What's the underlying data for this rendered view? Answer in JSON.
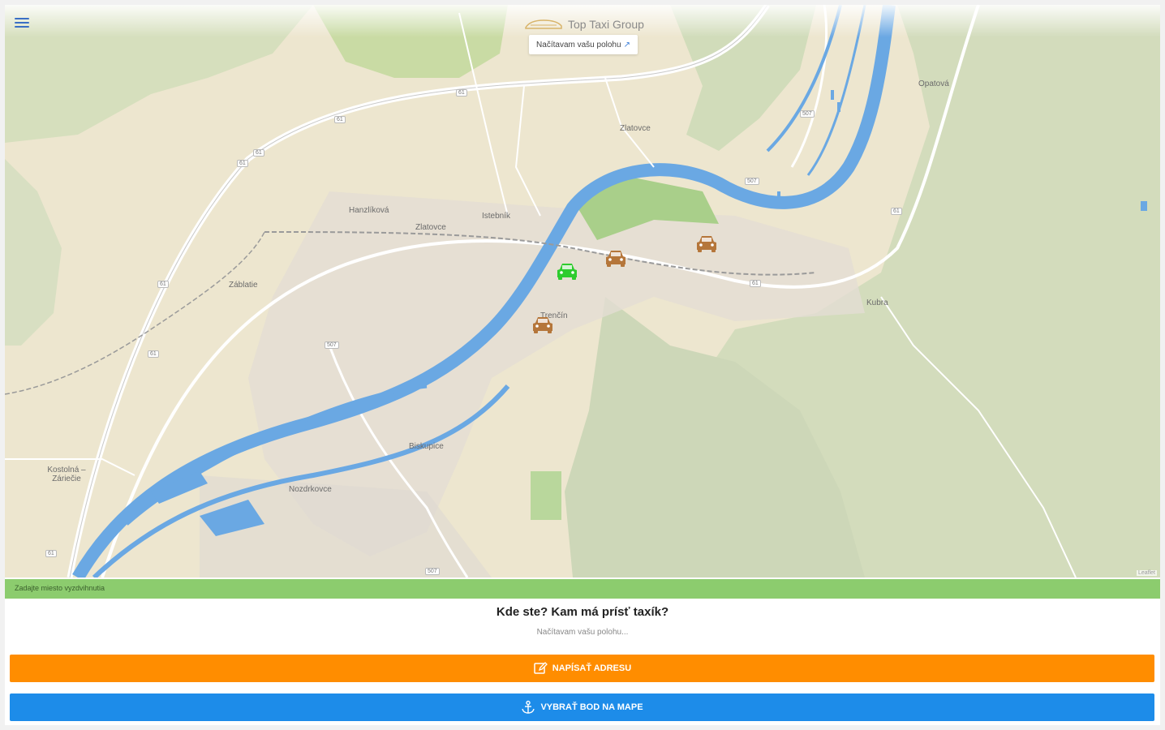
{
  "app": {
    "title": "Top Taxi Group",
    "locating_text": "Načítavam vašu polohu",
    "locating_icon": "location-arrow-icon"
  },
  "map": {
    "labels": [
      {
        "text": "Opatová"
      },
      {
        "text": "Zlatovce"
      },
      {
        "text": "Hanzlíková"
      },
      {
        "text": "Zlatovce"
      },
      {
        "text": "Kubra"
      },
      {
        "text": "Záblatie"
      },
      {
        "text": "Trenčín"
      },
      {
        "text": "Biskupice"
      },
      {
        "text": "Nozdrkovce"
      },
      {
        "text": "Kostolná – Záriečie"
      },
      {
        "text": "Istebník"
      }
    ],
    "shields": [
      "61",
      "61",
      "61",
      "61",
      "507",
      "507",
      "61",
      "61",
      "61",
      "61",
      "61",
      "507",
      "507"
    ],
    "attribution": "Leaflet",
    "taxi_icon_free": "car-icon-green",
    "taxi_icon_busy": "car-icon-brown",
    "colors": {
      "water": "#6aa8e3",
      "land": "#ede6cf",
      "forest": "#c9d7b0",
      "taxi_free": "#2ecc2e",
      "taxi_busy": "#b5763a"
    }
  },
  "status": {
    "text": "Zadajte miesto vyzdvihnutia",
    "color": "#8ccc6e"
  },
  "prompt": {
    "question": "Kde ste? Kam má prísť taxík?",
    "loading": "Načítavam vašu polohu..."
  },
  "buttons": {
    "write_address": "NAPÍSAŤ ADRESU",
    "write_address_icon": "edit-icon",
    "pick_on_map": "VYBRAŤ BOD NA MAPE",
    "pick_on_map_icon": "anchor-icon",
    "orange": "#ff8d00",
    "blue": "#1d8ce9"
  }
}
